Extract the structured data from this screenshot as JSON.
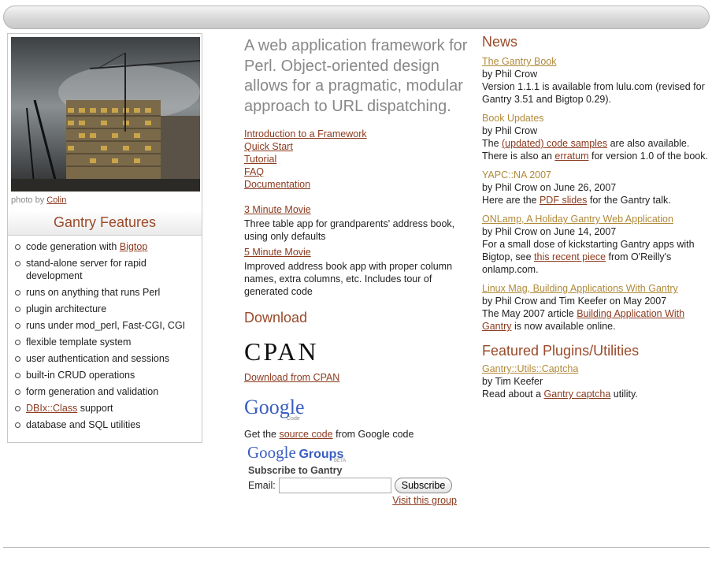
{
  "photo": {
    "credit_prefix": "photo by",
    "credit_name": "Colin"
  },
  "features": {
    "title": "Gantry Features",
    "items": [
      {
        "text": "code generation with ",
        "link": "Bigtop",
        "suffix": ""
      },
      {
        "text": "stand-alone server for rapid development",
        "link": "",
        "suffix": ""
      },
      {
        "text": "runs on anything that runs Perl",
        "link": "",
        "suffix": ""
      },
      {
        "text": "plugin architecture",
        "link": "",
        "suffix": ""
      },
      {
        "text": "runs under mod_perl, Fast-CGI, CGI",
        "link": "",
        "suffix": ""
      },
      {
        "text": "flexible template system",
        "link": "",
        "suffix": ""
      },
      {
        "text": "user authentication and sessions",
        "link": "",
        "suffix": ""
      },
      {
        "text": "built-in CRUD operations",
        "link": "",
        "suffix": ""
      },
      {
        "text": "form generation and validation",
        "link": "",
        "suffix": ""
      },
      {
        "text": "",
        "link": "DBIx::Class",
        "suffix": " support"
      },
      {
        "text": "database and SQL utilities",
        "link": "",
        "suffix": ""
      }
    ]
  },
  "main": {
    "tagline": "A web application framework for Perl. Object-oriented design allows for a pragmatic, modular approach to URL dispatching.",
    "links": [
      "Introduction to a Framework",
      "Quick Start",
      "Tutorial",
      "FAQ",
      "Documentation"
    ],
    "movie3": {
      "link": "3 Minute Movie",
      "desc": "Three table app for grandparents' address book, using only defaults"
    },
    "movie5": {
      "link": "5 Minute Movie",
      "desc": "Improved address book app with proper column names, extra columns, etc. Includes tour of generated code"
    },
    "download_title": "Download",
    "cpan_logo": "CPAN",
    "cpan_link": "Download from CPAN",
    "google_logo": "Google",
    "google_code_sub": "Code",
    "google_code_prefix": "Get the ",
    "google_code_link": "source code",
    "google_code_suffix": " from Google code",
    "groups_logo_google": "Google",
    "groups_logo_groups": "Groups",
    "groups_beta": "BETA",
    "subscribe_title": "Subscribe to Gantry",
    "email_label": "Email:",
    "subscribe_button": "Subscribe",
    "visit_group": "Visit this group"
  },
  "news": {
    "title": "News",
    "items": [
      {
        "title": "The Gantry Book",
        "by": "by Phil Crow",
        "body_parts": [
          "Version 1.1.1 is available from lulu.com (revised for Gantry 3.51 and Bigtop 0.29)."
        ],
        "body_links": []
      },
      {
        "title": "Book Updates",
        "by": "by Phil Crow",
        "body_parts": [
          "The ",
          " are also available. There is also an ",
          " for version 1.0 of the book."
        ],
        "body_links": [
          "(updated) code samples",
          "erratum"
        ]
      },
      {
        "title": "YAPC::NA 2007",
        "by": "by Phil Crow on June 26, 2007",
        "body_parts": [
          "Here are the ",
          " for the Gantry talk."
        ],
        "body_links": [
          "PDF slides"
        ]
      },
      {
        "title": "ONLamp, A Holiday Gantry Web Application",
        "by": "by Phil Crow on June 14, 2007",
        "body_parts": [
          "For a small dose of kickstarting Gantry apps with Bigtop, see ",
          " from O'Reilly's onlamp.com."
        ],
        "body_links": [
          "this recent piece"
        ]
      },
      {
        "title": "Linux Mag, Building Applications With Gantry",
        "by": "by Phil Crow and Tim Keefer on May 2007",
        "body_parts": [
          "The May 2007 article ",
          " is now available online."
        ],
        "body_links": [
          "Building Application With Gantry"
        ]
      }
    ]
  },
  "plugins": {
    "title": "Featured Plugins/Utilities",
    "item_title": "Gantry::Utils::Captcha",
    "by": "by Tim Keefer",
    "body_prefix": "Read about a ",
    "body_link": "Gantry captcha",
    "body_suffix": " utility."
  }
}
